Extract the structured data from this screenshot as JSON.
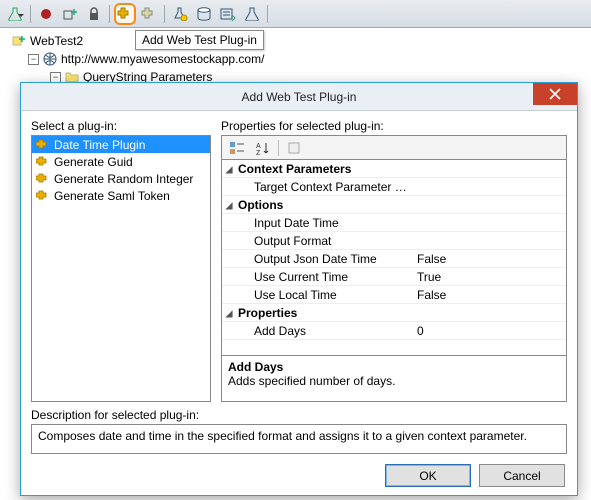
{
  "toolbar": {
    "tooltip": "Add Web Test Plug-in"
  },
  "tree": {
    "root": "WebTest2",
    "url": "http://www.myawesomestockapp.com/",
    "child": "QueryString Parameters"
  },
  "dialog": {
    "title": "Add Web Test Plug-in",
    "left": {
      "label": "Select a plug-in:",
      "items": [
        "Date Time Plugin",
        "Generate Guid",
        "Generate Random Integer",
        "Generate Saml Token"
      ],
      "selected_index": 0
    },
    "right": {
      "label": "Properties for selected plug-in:",
      "categories": [
        {
          "name": "Context Parameters",
          "props": [
            {
              "name": "Target Context Parameter Nam",
              "value": ""
            }
          ]
        },
        {
          "name": "Options",
          "props": [
            {
              "name": "Input Date Time",
              "value": ""
            },
            {
              "name": "Output Format",
              "value": ""
            },
            {
              "name": "Output Json Date Time",
              "value": "False"
            },
            {
              "name": "Use Current Time",
              "value": "True"
            },
            {
              "name": "Use Local Time",
              "value": "False"
            }
          ]
        },
        {
          "name": "Properties",
          "props": [
            {
              "name": "Add Days",
              "value": "0"
            }
          ]
        }
      ],
      "desc_title": "Add Days",
      "desc_text": "Adds specified number of days."
    },
    "desc_label": "Description for selected plug-in:",
    "desc_value": "Composes date and time in the specified format and assigns it to a given context parameter.",
    "ok": "OK",
    "cancel": "Cancel"
  }
}
